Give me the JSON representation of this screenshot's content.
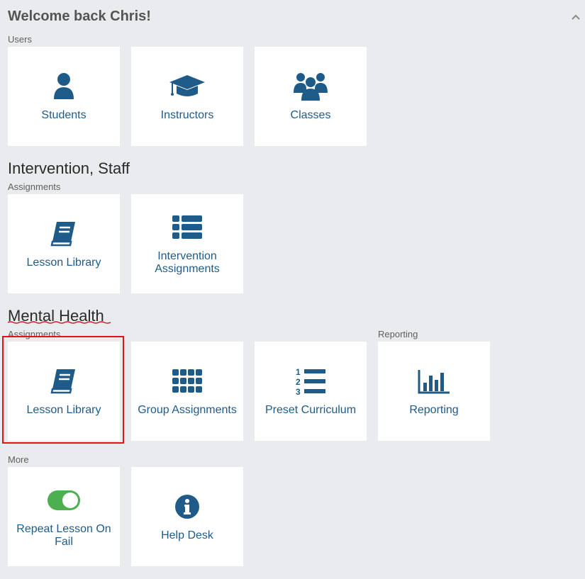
{
  "header": {
    "welcome": "Welcome back Chris!"
  },
  "users": {
    "label": "Users",
    "tiles": [
      {
        "label": "Students",
        "icon": "user-icon"
      },
      {
        "label": "Instructors",
        "icon": "graduation-cap-icon"
      },
      {
        "label": "Classes",
        "icon": "users-group-icon"
      }
    ]
  },
  "intervention": {
    "title": "Intervention, Staff",
    "label": "Assignments",
    "tiles": [
      {
        "label": "Lesson Library",
        "icon": "book-icon"
      },
      {
        "label": "Intervention Assignments",
        "icon": "list-icon"
      }
    ]
  },
  "mental_health": {
    "title": "Mental Health",
    "assignments_label": "Assignments",
    "reporting_label": "Reporting",
    "tiles": [
      {
        "label": "Lesson Library",
        "icon": "book-icon"
      },
      {
        "label": "Group Assignments",
        "icon": "grid-icon"
      },
      {
        "label": "Preset Curriculum",
        "icon": "numbered-list-icon"
      },
      {
        "label": "Reporting",
        "icon": "bar-chart-icon"
      }
    ]
  },
  "more": {
    "label": "More",
    "tiles": [
      {
        "label": "Repeat Lesson On Fail",
        "icon": "toggle-on-icon"
      },
      {
        "label": "Help Desk",
        "icon": "info-icon"
      }
    ]
  },
  "colors": {
    "background": "#e9ebef",
    "accent": "#1f5b88",
    "toggle_on": "#4caf50",
    "highlight_border": "#e0151b",
    "underline": "#d81b20"
  }
}
